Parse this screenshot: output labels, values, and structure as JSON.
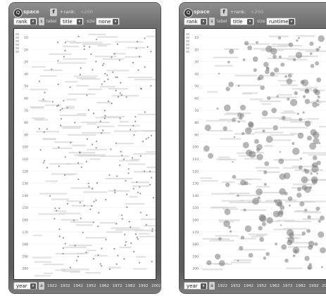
{
  "panels": [
    {
      "logo": "Q",
      "logo_text": "space",
      "f_label": "f",
      "query_label": "+rank:",
      "query_value": "<200",
      "y_select": "rank",
      "table_label": "label",
      "label_select": "title",
      "size_label": "size",
      "size_select": "none",
      "x_select": "year",
      "x_ticks": [
        "1922",
        "1932",
        "1942",
        "1952",
        "1962",
        "1972",
        "1982",
        "1992",
        "2002"
      ],
      "y_ticks": [
        "10",
        "20",
        "30",
        "40",
        "50",
        "60",
        "70",
        "80",
        "90",
        "100",
        "110",
        "120",
        "130",
        "140",
        "150",
        "160",
        "170",
        "180",
        "190",
        "200"
      ],
      "sized_points": false
    },
    {
      "logo": "Q",
      "logo_text": "space",
      "f_label": "f",
      "query_label": "+rank:",
      "query_value": "<200",
      "y_select": "rank",
      "table_label": "label",
      "label_select": "title",
      "size_label": "size",
      "size_select": "runtime",
      "x_select": "year",
      "x_ticks": [
        "1922",
        "1932",
        "1942",
        "1952",
        "1962",
        "1972",
        "1982",
        "1992",
        "2002"
      ],
      "y_ticks": [
        "10",
        "20",
        "30",
        "40",
        "50",
        "60",
        "70",
        "80",
        "90",
        "100",
        "110",
        "120",
        "130",
        "140",
        "150",
        "160",
        "170",
        "180",
        "190",
        "200"
      ],
      "sized_points": true
    }
  ],
  "colors": {
    "frame": "#6a6a6a",
    "plot_bg": "#ffffff",
    "point": "#7a7a7a",
    "label_text": "#b0b0b0"
  }
}
